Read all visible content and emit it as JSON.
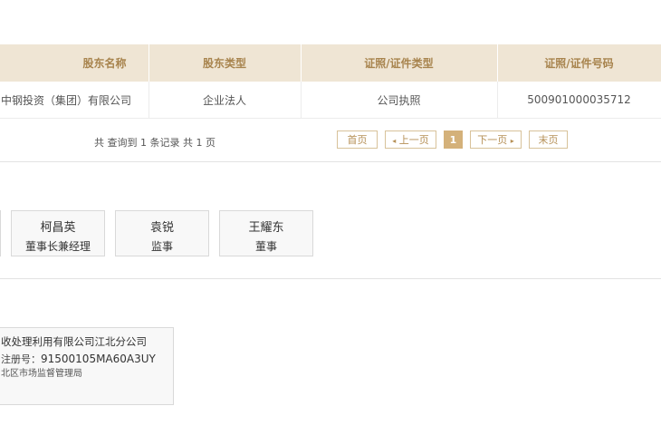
{
  "shareholders": {
    "headers": [
      "股东名称",
      "股东类型",
      "证照/证件类型",
      "证照/证件号码"
    ],
    "rows": [
      [
        "中钢投资（集团）有限公司",
        "企业法人",
        "公司执照",
        "500901000035712"
      ]
    ]
  },
  "pagination": {
    "summary": "共 查询到 1 条记录 共 1 页",
    "first": "首页",
    "prev": "上一页",
    "current": "1",
    "next": "下一页",
    "last": "末页"
  },
  "personnel": [
    {
      "name": "柯昌英",
      "role": "董事长兼经理"
    },
    {
      "name": "袁锐",
      "role": "监事"
    },
    {
      "name": "王耀东",
      "role": "董事"
    }
  ],
  "branch": {
    "name": "收处理利用有限公司江北分公司",
    "reg_label": "注册号：",
    "reg_no": "91500105MA60A3UY",
    "authority": "北区市场监督管理局"
  }
}
